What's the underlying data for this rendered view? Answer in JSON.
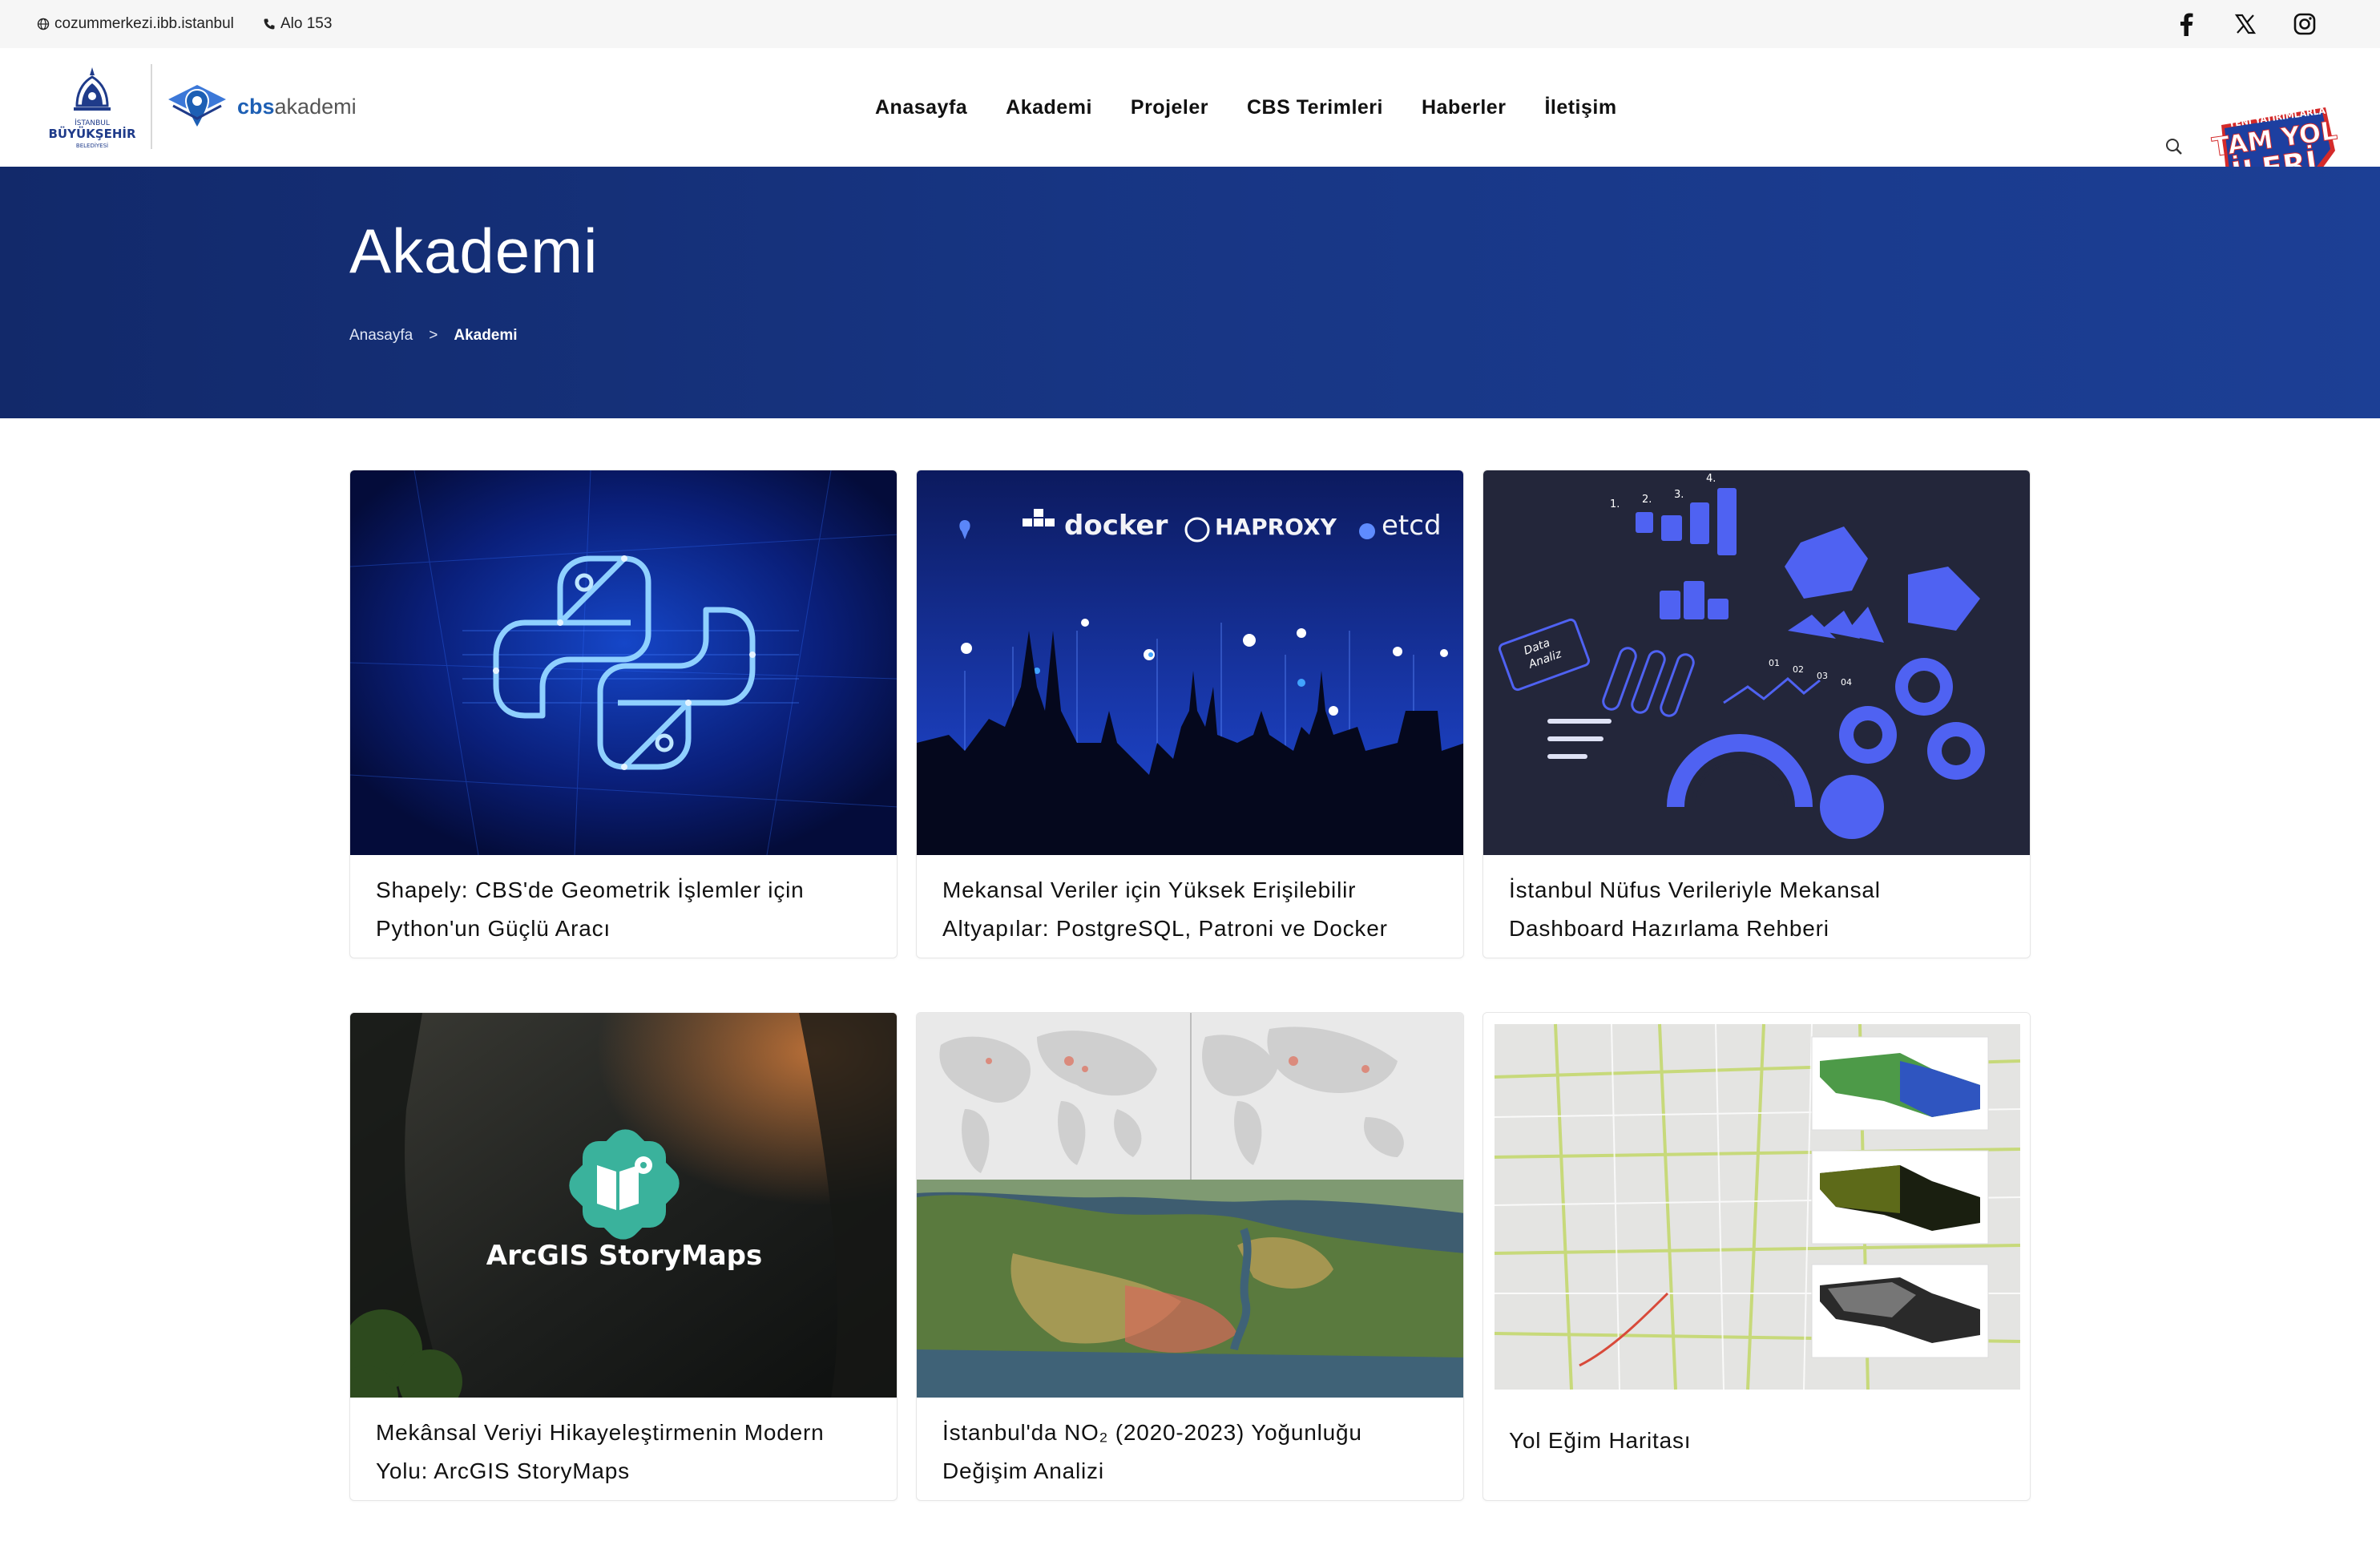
{
  "topbar": {
    "website": "cozummerkezi.ibb.istanbul",
    "phone": "Alo 153",
    "socials": [
      {
        "icon": "facebook-icon"
      },
      {
        "icon": "x-twitter-icon"
      },
      {
        "icon": "instagram-icon"
      }
    ]
  },
  "header": {
    "ibb_logo": {
      "line1": "İSTANBUL",
      "line2": "BÜYÜKŞEHİR",
      "line3": "BELEDİYESİ"
    },
    "cbs_logo": {
      "bold": "cbs",
      "rest": "akademi"
    },
    "nav": [
      "Anasayfa",
      "Akademi",
      "Projeler",
      "CBS Terimleri",
      "Haberler",
      "İletişim"
    ],
    "badge": {
      "small": "YENİ YATIRIMLARLA",
      "line1": "TAM YOL",
      "line2": "İLERİ"
    }
  },
  "hero": {
    "title": "Akademi",
    "breadcrumb": {
      "home": "Anasayfa",
      "separator": ">",
      "current": "Akademi"
    }
  },
  "cards": [
    {
      "title_line1": "Shapely: CBS'de Geometrik İşlemler için",
      "title_line2": "Python'un Güçlü Aracı"
    },
    {
      "title_line1": "Mekansal Veriler için Yüksek Erişilebilir",
      "title_line2": "Altyapılar: PostgreSQL, Patroni ve Docker",
      "logos": [
        "docker",
        "HAPROXY",
        "etcd"
      ]
    },
    {
      "title_line1": "İstanbul Nüfus Verileriyle Mekansal",
      "title_line2": "Dashboard Hazırlama Rehberi",
      "thumb_labels": {
        "tag_line1": "Data",
        "tag_line2": "Analiz",
        "steps": [
          "1.",
          "2.",
          "3.",
          "4."
        ],
        "nums": [
          "01",
          "02",
          "03",
          "04"
        ]
      }
    },
    {
      "title_line1": "Mekânsal Veriyi Hikayeleştirmenin Modern",
      "title_line2": "Yolu: ArcGIS StoryMaps",
      "thumb_text": "ArcGIS StoryMaps"
    },
    {
      "title_line1": "İstanbul'da NO₂ (2020-2023) Yoğunluğu",
      "title_line2": "Değişim Analizi"
    },
    {
      "title_line1": "Yol Eğim Haritası",
      "title_line2": ""
    }
  ],
  "colors": {
    "hero": "#173583",
    "accent": "#1d5fb4"
  }
}
